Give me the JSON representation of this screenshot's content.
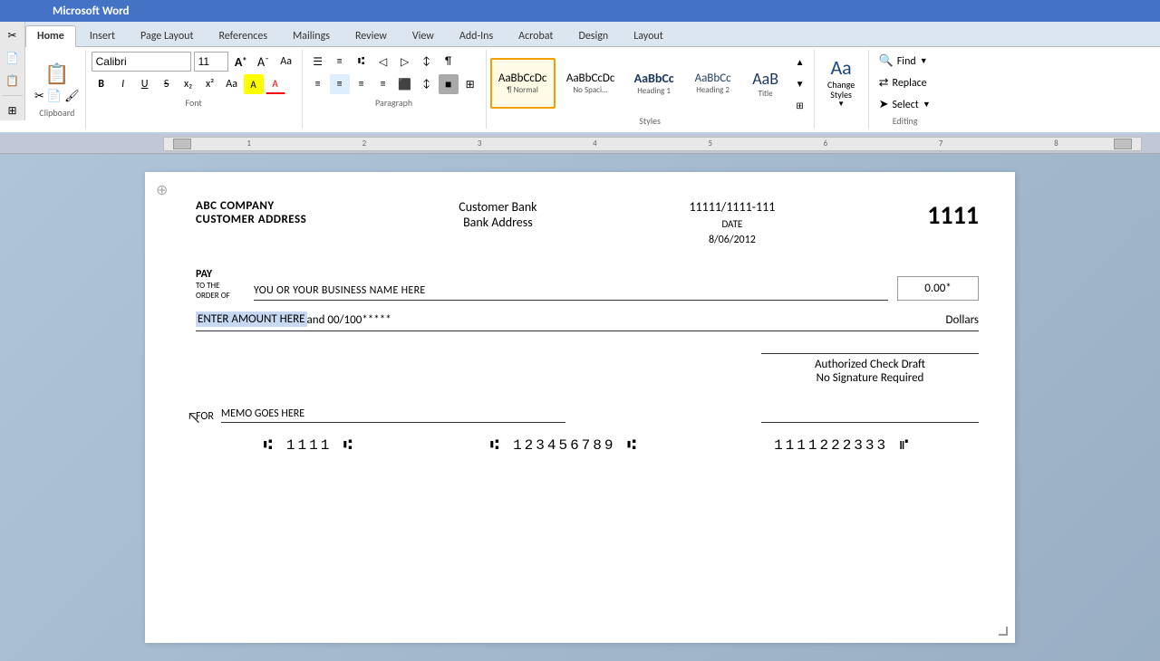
{
  "ribbon": {
    "tabs": [
      "Home",
      "Insert",
      "Page Layout",
      "References",
      "Mailings",
      "Review",
      "View",
      "Add-Ins",
      "Acrobat",
      "Design",
      "Layout"
    ],
    "active_tab": "Home"
  },
  "toolbar": {
    "font_name": "Calibri",
    "font_size": "11",
    "font_name_placeholder": "Calibri",
    "font_size_placeholder": "11",
    "bold": "B",
    "italic": "I",
    "underline": "U",
    "find_label": "Find",
    "replace_label": "Replace",
    "select_label": "Select",
    "editing_label": "Editing",
    "paragraph_label": "Paragraph",
    "font_label": "Font",
    "styles_label": "Styles",
    "change_styles_label": "Change\nStyles"
  },
  "styles": [
    {
      "label": "Normal",
      "preview": "AaBbCcDc",
      "active": true
    },
    {
      "label": "No Spaci...",
      "preview": "AaBbCcDc",
      "active": false
    },
    {
      "label": "Heading 1",
      "preview": "AaBbCc",
      "active": false
    },
    {
      "label": "Heading 2",
      "preview": "AaBbCc",
      "active": false
    },
    {
      "label": "Title",
      "preview": "AaB",
      "active": false
    }
  ],
  "check": {
    "company_name": "ABC COMPANY",
    "company_address": "CUSTOMER ADDRESS",
    "bank_name": "Customer Bank",
    "bank_address": "Bank Address",
    "routing_number": "11111/1111-111",
    "date_label": "DATE",
    "check_date": "8/06/2012",
    "check_number": "1111",
    "pay_label": "PAY",
    "to_label": "TO THE",
    "order_label": "ORDER OF",
    "payee_name": "YOU OR YOUR BUSINESS NAME HERE",
    "amount": "0.00*",
    "amount_words_highlighted": "ENTER AMOUNT HERE",
    "amount_words_rest": " and 00/100*****",
    "dollars_label": "Dollars",
    "authorized_line1": "Authorized Check Draft",
    "authorized_line2": "No Signature Required",
    "for_label": "FOR",
    "memo_text": "MEMO GOES HERE",
    "micr_check": "⑆ 1111 ⑆",
    "micr_routing": "⑆ 123456789 ⑆",
    "micr_account": "1111222333 ⑈"
  }
}
